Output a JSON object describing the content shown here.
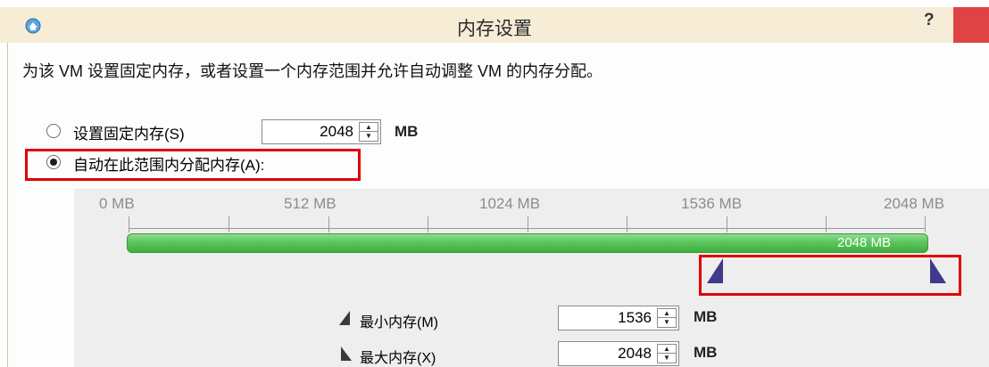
{
  "window": {
    "title": "内存设置",
    "help_label": "?",
    "icon": "hyper-v-icon"
  },
  "description": "为该 VM 设置固定内存，或者设置一个内存范围并允许自动调整 VM 的内存分配。",
  "options": {
    "fixed": {
      "label": "设置固定内存(S)",
      "selected": false,
      "value": "2048",
      "unit": "MB"
    },
    "auto": {
      "label": "自动在此范围内分配内存(A):",
      "selected": true
    }
  },
  "slider": {
    "scale_labels": [
      "0 MB",
      "512 MB",
      "1024 MB",
      "1536 MB",
      "2048 MB"
    ],
    "bar_label": "2048 MB",
    "bar_color": "#5cc45c",
    "handle_color": "#3f3a8c",
    "min_value": 1536,
    "max_value": 2048,
    "range_max": 2048
  },
  "min_memory": {
    "label": "最小内存(M)",
    "value": "1536",
    "unit": "MB",
    "icon": "min-memory-icon"
  },
  "max_memory": {
    "label": "最大内存(X)",
    "value": "2048",
    "unit": "MB",
    "icon": "max-memory-icon"
  },
  "highlight_color": "#e00000"
}
